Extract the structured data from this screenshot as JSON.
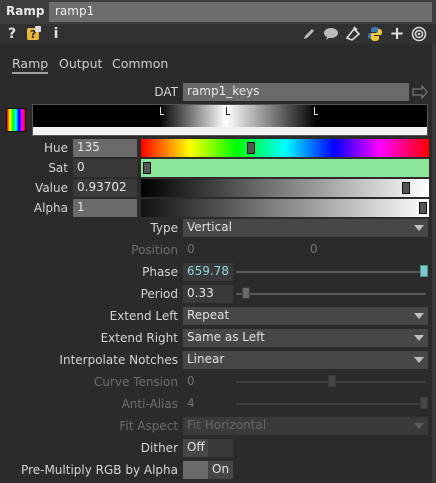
{
  "header": {
    "op_type": "Ramp",
    "op_name": "ramp1"
  },
  "toolbar": {
    "help_glyph": "?",
    "info_glyph": "i",
    "icons": [
      "help-icon",
      "python-help-icon",
      "info-icon",
      "pencil-icon",
      "comment-icon",
      "clone-icon",
      "python-icon",
      "add-icon",
      "viewer-target-icon"
    ]
  },
  "tabs": [
    {
      "label": "Ramp",
      "active": true
    },
    {
      "label": "Output",
      "active": false
    },
    {
      "label": "Common",
      "active": false
    }
  ],
  "dat": {
    "label": "DAT",
    "value": "ramp1_keys"
  },
  "color_params": {
    "hue": {
      "label": "Hue",
      "value": "135"
    },
    "sat": {
      "label": "Sat",
      "value": "0"
    },
    "value": {
      "label": "Value",
      "value": "0.93702"
    },
    "alpha": {
      "label": "Alpha",
      "value": "1"
    }
  },
  "params": {
    "type": {
      "label": "Type",
      "value": "Vertical"
    },
    "position": {
      "label": "Position",
      "x": "0",
      "y": "0"
    },
    "phase": {
      "label": "Phase",
      "value": "659.78"
    },
    "period": {
      "label": "Period",
      "value": "0.33"
    },
    "extend_left": {
      "label": "Extend Left",
      "value": "Repeat"
    },
    "extend_right": {
      "label": "Extend Right",
      "value": "Same as Left"
    },
    "interpolate": {
      "label": "Interpolate Notches",
      "value": "Linear"
    },
    "curve_tension": {
      "label": "Curve Tension",
      "value": "0"
    },
    "anti_alias": {
      "label": "Anti-Alias",
      "value": "4"
    },
    "fit_aspect": {
      "label": "Fit Aspect",
      "value": "Fit Horizontal"
    },
    "dither": {
      "label": "Dither",
      "off": "Off",
      "on": ""
    },
    "premultiply": {
      "label": "Pre-Multiply RGB by Alpha",
      "off": "",
      "on": "On"
    }
  },
  "colors": {
    "accent_cyan": "#7ec9c9",
    "sat_bar": "#8ce69a",
    "panel_bg": "#2b2b2b"
  }
}
